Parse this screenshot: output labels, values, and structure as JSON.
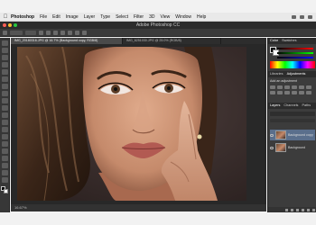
{
  "menubar": {
    "app": "Photoshop",
    "items": [
      "File",
      "Edit",
      "Image",
      "Layer",
      "Type",
      "Select",
      "Filter",
      "3D",
      "View",
      "Window",
      "Help"
    ]
  },
  "app_title": "Adobe Photoshop CC",
  "doc_tabs": [
    {
      "label": "IMG_20180316.JPG @ 16.7% (Background copy, RGB/8)",
      "active": true
    },
    {
      "label": "IMG_6251030.JPG @ 25.0% (RGB/8)",
      "active": false
    }
  ],
  "status": "16.67%",
  "panels": {
    "color_tabs": [
      "Color",
      "Swatches"
    ],
    "adjustments_tabs": [
      "Libraries",
      "Adjustments"
    ],
    "adjustments_title": "Add an adjustment",
    "layers_tabs": [
      "Layers",
      "Channels",
      "Paths"
    ],
    "layers": [
      {
        "name": "Background copy",
        "active": true
      },
      {
        "name": "Background",
        "active": false
      }
    ]
  },
  "colors": {
    "chrome": "#2b2b2b",
    "panel": "#3c3c3c",
    "accent": "#5a6f8c"
  }
}
